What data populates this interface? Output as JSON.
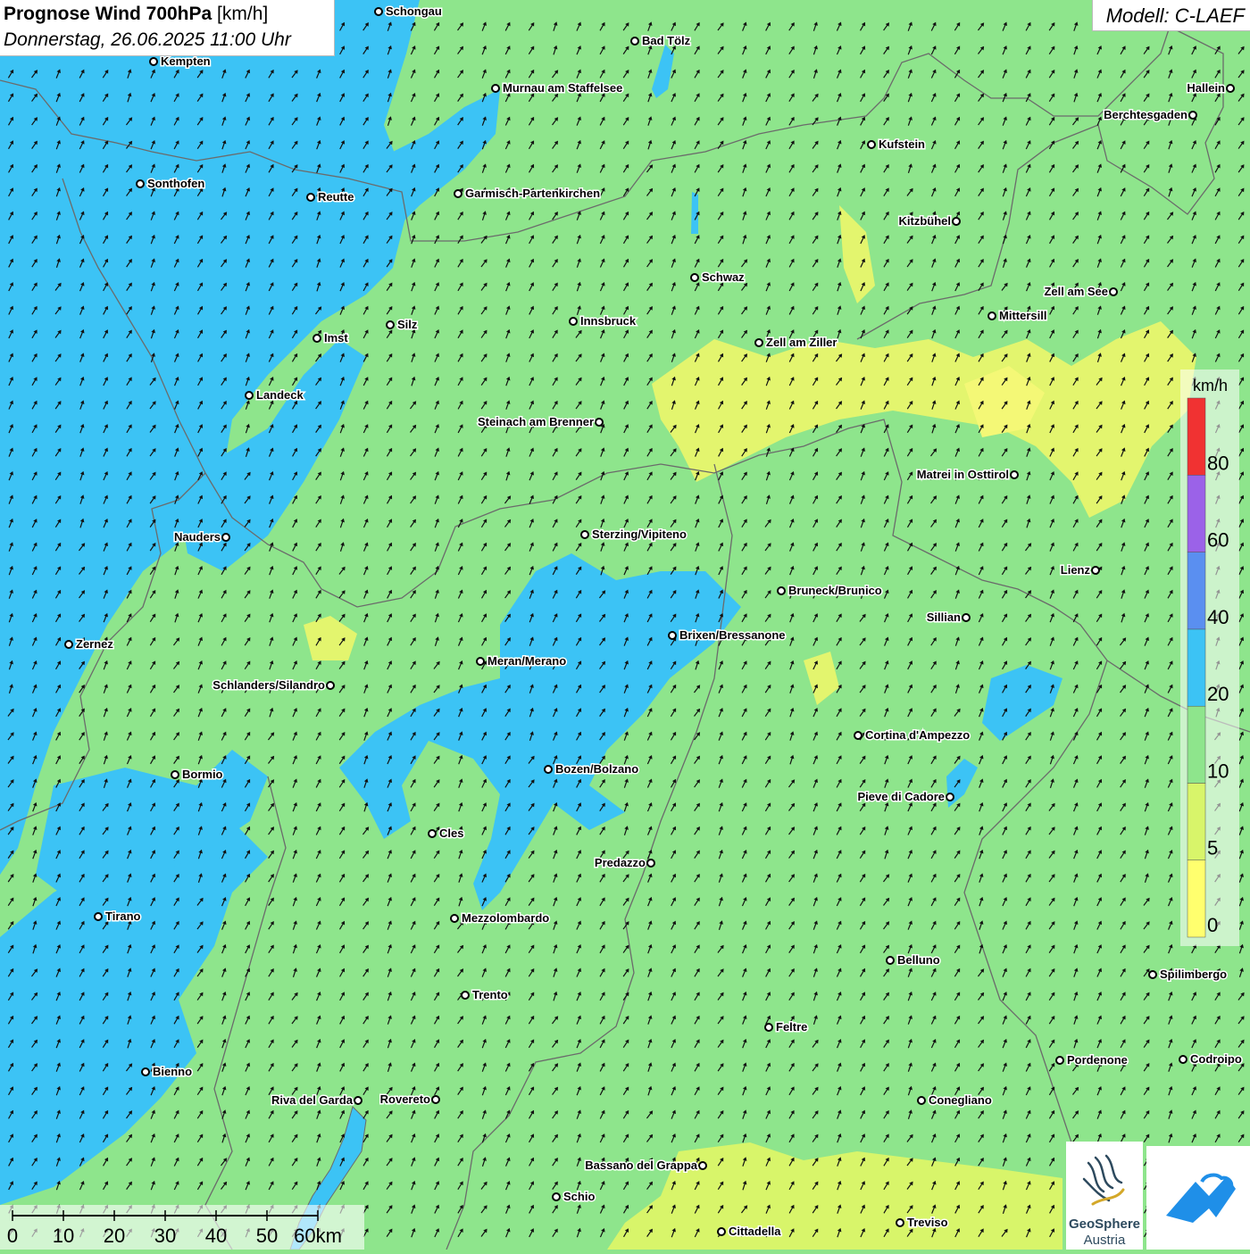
{
  "title": {
    "main": "Prognose Wind 700hPa",
    "unit": "[km/h]",
    "date": "Donnerstag, 26.06.2025 11:00 Uhr"
  },
  "model": "Modell: C-LAEF",
  "legend": {
    "unit": "km/h",
    "classes": [
      {
        "label": "0",
        "color": "#ffff6e"
      },
      {
        "label": "5",
        "color": "#d8f56a"
      },
      {
        "label": "10",
        "color": "#8ee58c"
      },
      {
        "label": "20",
        "color": "#3cc3f5"
      },
      {
        "label": "40",
        "color": "#5a8ff0"
      },
      {
        "label": "60",
        "color": "#9b62e8"
      },
      {
        "label": "80",
        "color": "#f03232"
      }
    ]
  },
  "scalebar": {
    "labels": [
      "0",
      "10",
      "20",
      "30",
      "40",
      "50",
      "60km"
    ]
  },
  "logos": {
    "geosphere_line1": "GeoSphere",
    "geosphere_line2": "Austria"
  },
  "colors": {
    "calm": "#ffff6e",
    "light": "#d8f56a",
    "moderate": "#8ee58c",
    "fresh": "#3cc3f5",
    "strong": "#5a8ff0",
    "border": "#6b6b6b",
    "arrow": "#111111",
    "app_logo": "#1f8fe8"
  },
  "places": [
    {
      "name": "Schongau",
      "side": "r"
    },
    {
      "name": "Bad Tölz",
      "side": "r"
    },
    {
      "name": "Kempten",
      "side": "r"
    },
    {
      "name": "Murnau am Staffelsee",
      "side": "r"
    },
    {
      "name": "Hallein",
      "side": "l"
    },
    {
      "name": "Berchtesgaden",
      "side": "l"
    },
    {
      "name": "Kufstein",
      "side": "r"
    },
    {
      "name": "Sonthofen",
      "side": "r"
    },
    {
      "name": "Reutte",
      "side": "r"
    },
    {
      "name": "Garmisch-Partenkirchen",
      "side": "r"
    },
    {
      "name": "Kitzbühel",
      "side": "l"
    },
    {
      "name": "Schwaz",
      "side": "r"
    },
    {
      "name": "Zell am See",
      "side": "l"
    },
    {
      "name": "Innsbruck",
      "side": "r"
    },
    {
      "name": "Silz",
      "side": "r"
    },
    {
      "name": "Mittersill",
      "side": "r"
    },
    {
      "name": "Imst",
      "side": "r"
    },
    {
      "name": "Zell am Ziller",
      "side": "r"
    },
    {
      "name": "Landeck",
      "side": "r"
    },
    {
      "name": "Steinach am Brenner",
      "side": "l"
    },
    {
      "name": "Matrei in Osttirol",
      "side": "l"
    },
    {
      "name": "Nauders",
      "side": "l"
    },
    {
      "name": "Sterzing/Vipiteno",
      "side": "r"
    },
    {
      "name": "Lienz",
      "side": "l"
    },
    {
      "name": "Bruneck/Brunico",
      "side": "r"
    },
    {
      "name": "Sillian",
      "side": "l"
    },
    {
      "name": "Brixen/Bressanone",
      "side": "r"
    },
    {
      "name": "Zernez",
      "side": "r"
    },
    {
      "name": "Meran/Merano",
      "side": "r"
    },
    {
      "name": "Schlanders/Silandro",
      "side": "l"
    },
    {
      "name": "Cortina d'Ampezzo",
      "side": "r"
    },
    {
      "name": "Bozen/Bolzano",
      "side": "r"
    },
    {
      "name": "Bormio",
      "side": "r"
    },
    {
      "name": "Pieve di Cadore",
      "side": "l"
    },
    {
      "name": "Cles",
      "side": "r"
    },
    {
      "name": "Predazzo",
      "side": "l"
    },
    {
      "name": "Tirano",
      "side": "r"
    },
    {
      "name": "Mezzolombardo",
      "side": "r"
    },
    {
      "name": "Belluno",
      "side": "r"
    },
    {
      "name": "Spilimbergo",
      "side": "r"
    },
    {
      "name": "Trento",
      "side": "r"
    },
    {
      "name": "Feltre",
      "side": "r"
    },
    {
      "name": "Pordenone",
      "side": "r"
    },
    {
      "name": "Codroipo",
      "side": "r"
    },
    {
      "name": "Bienno",
      "side": "r"
    },
    {
      "name": "Riva del Garda",
      "side": "l"
    },
    {
      "name": "Rovereto",
      "side": "l"
    },
    {
      "name": "Conegliano",
      "side": "r"
    },
    {
      "name": "Bassano del Grappa",
      "side": "l"
    },
    {
      "name": "Schio",
      "side": "r"
    },
    {
      "name": "Treviso",
      "side": "r"
    },
    {
      "name": "Cittadella",
      "side": "r"
    }
  ]
}
